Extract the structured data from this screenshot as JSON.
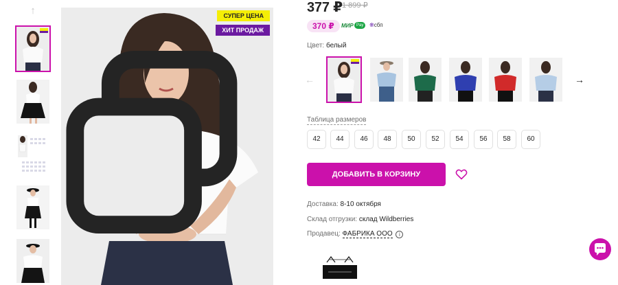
{
  "product": {
    "price": "377 ₽",
    "old_price": "1 899 ₽",
    "wallet_price": "370 ₽",
    "color_label": "Цвет:",
    "color_value": "белый",
    "badges": {
      "super": "СУПЕР ЦЕНА",
      "hit": "ХИТ ПРОДАЖ"
    }
  },
  "payment": {
    "mir": "МИР",
    "pay": "Pay",
    "sbp": "сбп"
  },
  "colors": [
    {
      "name": "white",
      "color": "#ffffff"
    },
    {
      "name": "light-blue",
      "color": "#a8c4e0"
    },
    {
      "name": "green",
      "color": "#1d6b4a"
    },
    {
      "name": "blue",
      "color": "#2f3fb0"
    },
    {
      "name": "red",
      "color": "#d12a2a"
    },
    {
      "name": "sky",
      "color": "#b5cde6"
    }
  ],
  "sizes": {
    "table_label": "Таблица размеров",
    "items": [
      "42",
      "44",
      "46",
      "48",
      "50",
      "52",
      "54",
      "56",
      "58",
      "60"
    ]
  },
  "cart": {
    "add_label": "ДОБАВИТЬ В КОРЗИНУ"
  },
  "delivery": {
    "label": "Доставка:",
    "value": "8-10 октября"
  },
  "warehouse": {
    "label": "Склад отгрузки:",
    "value": "склад Wildberries"
  },
  "seller": {
    "label": "Продавец:",
    "value": "ФАБРИКА ООО",
    "info": "i"
  },
  "accent_color": "#cb11ab"
}
